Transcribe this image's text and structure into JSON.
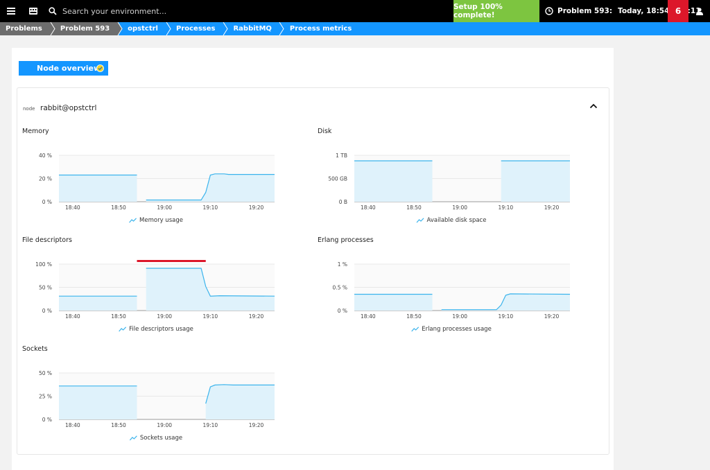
{
  "topbar": {
    "search_placeholder": "Search your environment...",
    "setup_label": "Setup 100% complete!",
    "problem_label": "Problem 593:",
    "time_label": "Today, 18:54 - 19:11",
    "problem_count": "6",
    "icons": [
      "menu-icon",
      "dashboard-icon",
      "search-icon",
      "clock-icon",
      "user-icon"
    ]
  },
  "breadcrumbs": [
    "Problems",
    "Problem 593",
    "opstctrl",
    "Processes",
    "RabbitMQ",
    "Process metrics"
  ],
  "node_overview": {
    "label": "Node overview"
  },
  "node": {
    "label": "node",
    "name": "rabbit@opstctrl"
  },
  "colors": {
    "accent": "#1496ff",
    "series_line": "#3bb4ec",
    "series_fill": "#dff2fb",
    "alert": "#dc172a",
    "setup": "#7dc540"
  },
  "chart_data": [
    {
      "type": "area",
      "title": "Memory",
      "legend": "Memory usage",
      "x_ticks": [
        "18:40",
        "18:50",
        "19:00",
        "19:10",
        "19:20"
      ],
      "y_ticks": [
        "40 %",
        "20 %",
        "0 %"
      ],
      "ylim": [
        0,
        40
      ],
      "segments": [
        [
          [
            0,
            23
          ],
          [
            17,
            23
          ]
        ],
        [
          [
            19,
            1.5
          ],
          [
            31,
            1.5
          ],
          [
            32,
            8
          ],
          [
            33,
            23
          ],
          [
            34,
            24
          ],
          [
            36,
            24
          ],
          [
            37,
            23.5
          ],
          [
            47,
            23.5
          ]
        ]
      ]
    },
    {
      "type": "area",
      "title": "Disk",
      "legend": "Available disk space",
      "x_ticks": [
        "18:40",
        "18:50",
        "19:00",
        "19:10",
        "19:20"
      ],
      "y_ticks": [
        "1 TB",
        "500 GB",
        "0 B"
      ],
      "ylim": [
        0,
        1000
      ],
      "segments": [
        [
          [
            0,
            880
          ],
          [
            17,
            880
          ]
        ],
        [
          [
            32,
            880
          ],
          [
            47,
            880
          ]
        ]
      ]
    },
    {
      "type": "area",
      "title": "File descriptors",
      "legend": "File descriptors usage",
      "x_ticks": [
        "18:40",
        "18:50",
        "19:00",
        "19:10",
        "19:20"
      ],
      "y_ticks": [
        "100 %",
        "50 %",
        "0 %"
      ],
      "ylim": [
        0,
        100
      ],
      "problem_range": [
        17,
        32
      ],
      "segments": [
        [
          [
            0,
            31
          ],
          [
            17,
            31
          ]
        ],
        [
          [
            19,
            91
          ],
          [
            31,
            91
          ],
          [
            32,
            52
          ],
          [
            33,
            31
          ],
          [
            35,
            32
          ],
          [
            47,
            31
          ]
        ]
      ]
    },
    {
      "type": "area",
      "title": "Erlang processes",
      "legend": "Erlang processes usage",
      "x_ticks": [
        "18:40",
        "18:50",
        "19:00",
        "19:10",
        "19:20"
      ],
      "y_ticks": [
        "1 %",
        "0.5 %",
        "0 %"
      ],
      "ylim": [
        0,
        1
      ],
      "segments": [
        [
          [
            0,
            0.35
          ],
          [
            17,
            0.35
          ]
        ],
        [
          [
            19,
            0.02
          ],
          [
            31,
            0.02
          ],
          [
            32,
            0.12
          ],
          [
            33,
            0.33
          ],
          [
            34,
            0.36
          ],
          [
            47,
            0.35
          ]
        ]
      ]
    },
    {
      "type": "area",
      "title": "Sockets",
      "legend": "Sockets usage",
      "x_ticks": [
        "18:40",
        "18:50",
        "19:00",
        "19:10",
        "19:20"
      ],
      "y_ticks": [
        "50 %",
        "25 %",
        "0 %"
      ],
      "ylim": [
        0,
        50
      ],
      "segments": [
        [
          [
            0,
            36
          ],
          [
            17,
            36
          ]
        ],
        [
          [
            32,
            17
          ],
          [
            33,
            35
          ],
          [
            34,
            37
          ],
          [
            36,
            37.5
          ],
          [
            38,
            37
          ],
          [
            47,
            37
          ]
        ]
      ]
    }
  ]
}
